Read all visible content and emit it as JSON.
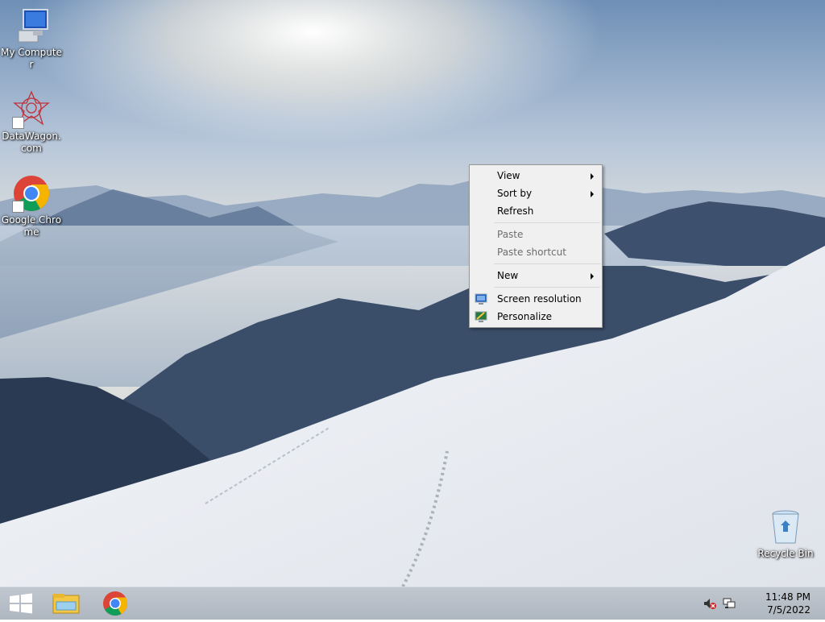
{
  "desktop": {
    "icons": [
      {
        "label": "My Computer",
        "icon": "computer-icon"
      },
      {
        "label": "DataWagon.com",
        "icon": "datawagon-icon"
      },
      {
        "label": "Google Chrome",
        "icon": "chrome-icon"
      },
      {
        "label": "Recycle Bin",
        "icon": "recycle-bin-icon"
      }
    ]
  },
  "context_menu": {
    "items": [
      {
        "label": "View",
        "submenu": true
      },
      {
        "label": "Sort by",
        "submenu": true
      },
      {
        "label": "Refresh"
      },
      {
        "label": "Paste",
        "disabled": true
      },
      {
        "label": "Paste shortcut",
        "disabled": true
      },
      {
        "label": "New",
        "submenu": true
      },
      {
        "label": "Screen resolution",
        "icon": "screen-resolution-icon"
      },
      {
        "label": "Personalize",
        "icon": "personalize-icon"
      }
    ]
  },
  "taskbar": {
    "pinned": [
      "windows-start-icon",
      "file-explorer-icon",
      "chrome-icon"
    ],
    "tray_icons": [
      "volume-muted-icon",
      "network-icon"
    ],
    "clock": {
      "time": "11:48 PM",
      "date": "7/5/2022"
    }
  },
  "colors": {
    "menu_bg": "#f0f0f0",
    "taskbar_bg": "#b7bec8",
    "disabled_text": "#6d6d6d"
  }
}
